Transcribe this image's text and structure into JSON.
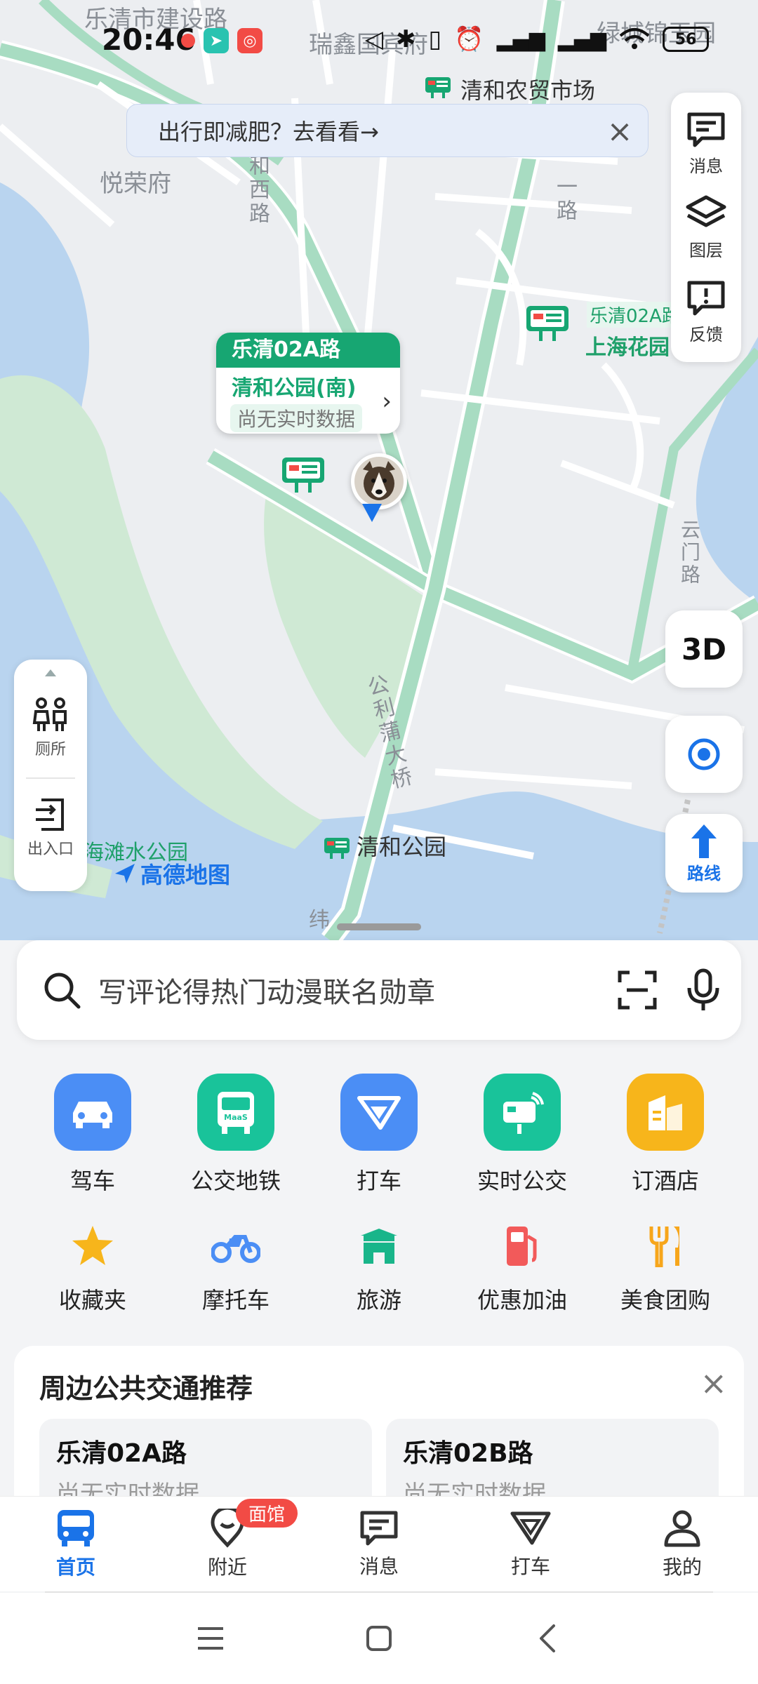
{
  "status_bar": {
    "time": "20:46",
    "battery": "56"
  },
  "banner": {
    "text": "出行即减肥？去看看→"
  },
  "map": {
    "labels": {
      "road_jianshe": "乐清市建设路",
      "ruixin": "瑞鑫国宾府",
      "lvcheng": "绿城锦玉园",
      "market": "清和农贸市场",
      "yuerong": "悦荣府",
      "he_xi_lu": "和西路",
      "lu_right": "一路",
      "shanghai_huayuan": "上海花园",
      "bus_route_label": "乐清02A路",
      "yunmen_lu": "云门路",
      "bridge": "公利蒲大桥",
      "qinghe_park": "清和公园",
      "haitan_park": "海滩水公园",
      "amap_brand": "高德地图",
      "wei_road": "纬"
    },
    "bus_popup": {
      "route": "乐清02A路",
      "stop": "清和公园(南)",
      "status": "尚无实时数据"
    }
  },
  "right_tools": [
    {
      "label": "消息",
      "icon": "message-icon"
    },
    {
      "label": "图层",
      "icon": "layers-icon"
    },
    {
      "label": "反馈",
      "icon": "feedback-icon"
    }
  ],
  "floating": {
    "btn_3d": "3D",
    "route": "路线"
  },
  "left_tools": [
    {
      "label": "厕所",
      "icon": "toilet-icon"
    },
    {
      "label": "出入口",
      "icon": "entrance-icon"
    }
  ],
  "search": {
    "placeholder": "写评论得热门动漫联名勋章"
  },
  "quick_grid": {
    "row1": [
      {
        "label": "驾车",
        "icon": "car-icon",
        "color": "#4b8ef5"
      },
      {
        "label": "公交地铁",
        "icon": "bus-maas-icon",
        "color": "#19c39a"
      },
      {
        "label": "打车",
        "icon": "taxi-icon",
        "color": "#4b8ef5"
      },
      {
        "label": "实时公交",
        "icon": "realtime-bus-icon",
        "color": "#19c39a"
      },
      {
        "label": "订酒店",
        "icon": "hotel-icon",
        "color": "#f7b51b"
      }
    ],
    "row2": [
      {
        "label": "收藏夹",
        "icon": "star-icon",
        "color": "#f7b51b"
      },
      {
        "label": "摩托车",
        "icon": "motorcycle-icon",
        "color": "#4b8ef5"
      },
      {
        "label": "旅游",
        "icon": "travel-icon",
        "color": "#19b58a"
      },
      {
        "label": "优惠加油",
        "icon": "fuel-icon",
        "color": "#f25a5a"
      },
      {
        "label": "美食团购",
        "icon": "food-icon",
        "color": "#f7a61b"
      }
    ]
  },
  "recommend": {
    "title": "周边公共交通推荐",
    "cards": [
      {
        "route": "乐清02A路",
        "status": "尚无实时数据"
      },
      {
        "route": "乐清02B路",
        "status": "尚无实时数据"
      }
    ]
  },
  "tabbar": [
    {
      "label": "首页",
      "icon": "home-bus-icon",
      "active": true
    },
    {
      "label": "附近",
      "icon": "nearby-icon",
      "badge": "面馆"
    },
    {
      "label": "消息",
      "icon": "message-icon"
    },
    {
      "label": "打车",
      "icon": "taxi-icon"
    },
    {
      "label": "我的",
      "icon": "profile-icon"
    }
  ],
  "colors": {
    "accent": "#1a73e8",
    "green": "#17a672",
    "water": "#b9d4ef",
    "park": "#cfe9d4"
  }
}
